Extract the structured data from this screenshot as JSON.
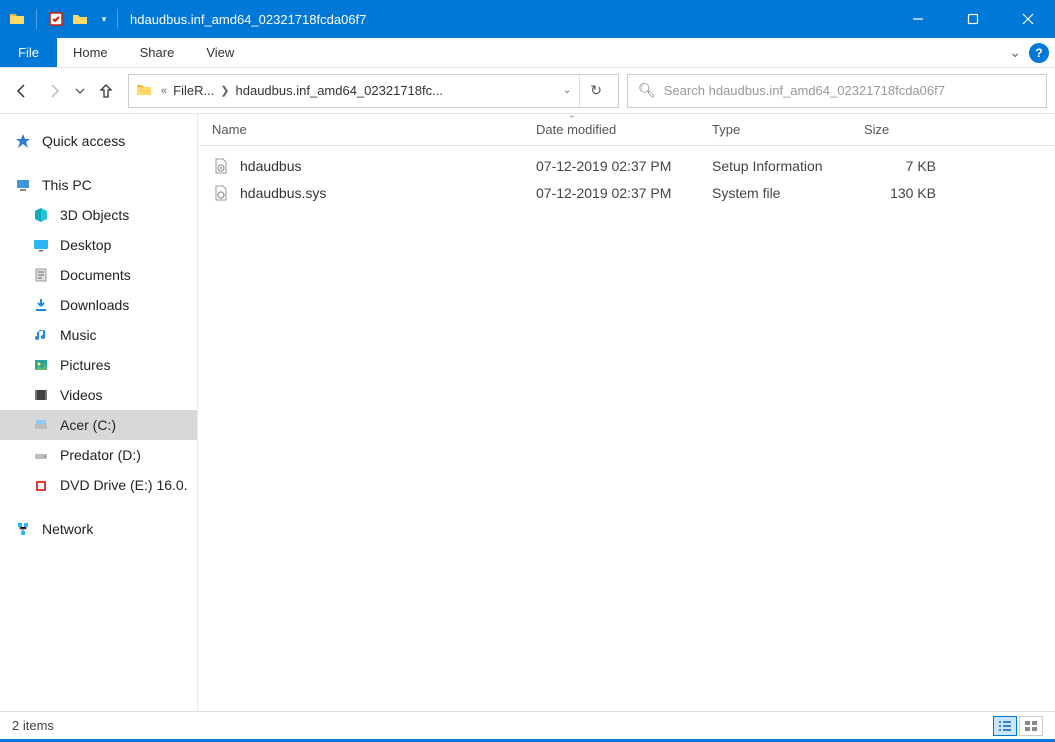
{
  "title": "hdaudbus.inf_amd64_02321718fcda06f7",
  "ribbon": {
    "file": "File",
    "tabs": [
      "Home",
      "Share",
      "View"
    ]
  },
  "breadcrumbs": {
    "prefix": "«",
    "segments": [
      "FileR...",
      "hdaudbus.inf_amd64_02321718fc..."
    ]
  },
  "search": {
    "placeholder": "Search hdaudbus.inf_amd64_02321718fcda06f7"
  },
  "sidebar": {
    "quick_access": "Quick access",
    "this_pc": "This PC",
    "items": [
      {
        "label": "3D Objects"
      },
      {
        "label": "Desktop"
      },
      {
        "label": "Documents"
      },
      {
        "label": "Downloads"
      },
      {
        "label": "Music"
      },
      {
        "label": "Pictures"
      },
      {
        "label": "Videos"
      },
      {
        "label": "Acer (C:)"
      },
      {
        "label": "Predator (D:)"
      },
      {
        "label": "DVD Drive (E:) 16.0."
      }
    ],
    "network": "Network"
  },
  "columns": {
    "name": "Name",
    "date": "Date modified",
    "type": "Type",
    "size": "Size"
  },
  "files": [
    {
      "name": "hdaudbus",
      "date": "07-12-2019 02:37 PM",
      "type": "Setup Information",
      "size": "7 KB"
    },
    {
      "name": "hdaudbus.sys",
      "date": "07-12-2019 02:37 PM",
      "type": "System file",
      "size": "130 KB"
    }
  ],
  "status": "2 items"
}
